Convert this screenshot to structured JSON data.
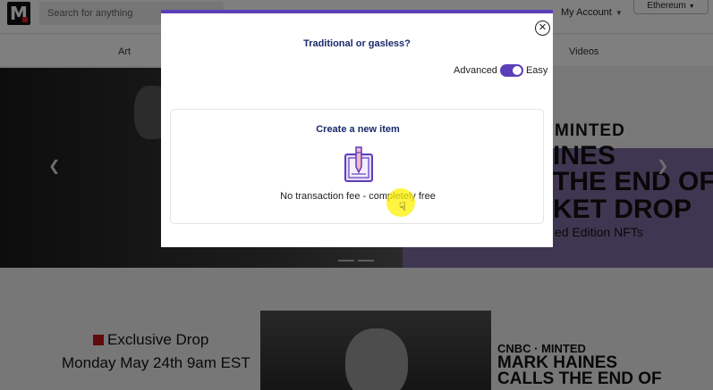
{
  "header": {
    "logo_letter": "M",
    "search_placeholder": "Search for anything",
    "account_label": "My Account",
    "network_label": "Ethereum"
  },
  "categories": [
    "Art",
    "Videos"
  ],
  "hero": {
    "brand_line": "MINTED",
    "headline_lines": [
      "INES",
      "THE END OF",
      "KET DROP"
    ],
    "subline": "ed Edition NFTs"
  },
  "promo": {
    "tag": "Exclusive Drop",
    "date": "Monday May 24th 9am EST",
    "brand": "CNBC · MINTED",
    "headline_lines": [
      "MARK HAINES",
      "CALLS THE END OF"
    ]
  },
  "modal": {
    "title": "Traditional or gasless?",
    "toggle_left": "Advanced",
    "toggle_right": "Easy",
    "toggle_state": "Easy",
    "card": {
      "title": "Create a new item",
      "description": "No transaction fee - completely free",
      "icon": "nft-card-pencil-icon"
    }
  },
  "colors": {
    "accent": "#5b3fb8",
    "title_text": "#1a2a6c",
    "cursor_highlight": "#fff000"
  }
}
